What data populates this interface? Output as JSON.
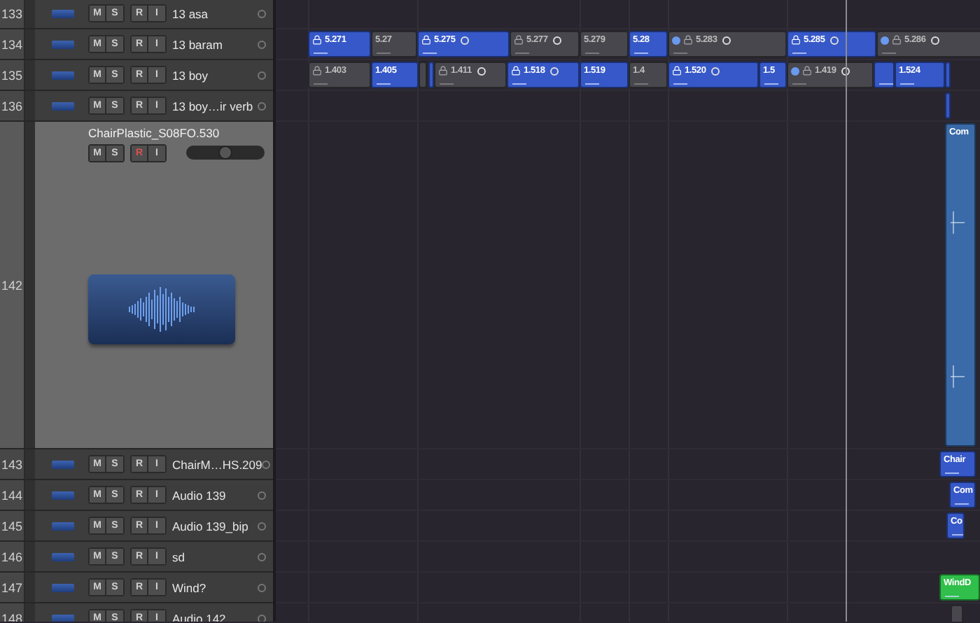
{
  "tracks": [
    {
      "number": "133",
      "name": "13 asa",
      "selected": false,
      "armed": false,
      "buttons": {
        "mute": "M",
        "solo": "S",
        "record": "R",
        "input": "I"
      }
    },
    {
      "number": "134",
      "name": "13 baram",
      "selected": false,
      "armed": false,
      "buttons": {
        "mute": "M",
        "solo": "S",
        "record": "R",
        "input": "I"
      },
      "regions": [
        {
          "label": "5.271",
          "selected": true,
          "dot": false
        },
        {
          "label": "5.27",
          "selected": false,
          "dot": false
        },
        {
          "label": "5.275",
          "selected": true,
          "dot": false
        },
        {
          "label": "5.277",
          "selected": false,
          "dot": false
        },
        {
          "label": "5.279",
          "selected": false,
          "dot": false
        },
        {
          "label": "5.28",
          "selected": true,
          "dot": false
        },
        {
          "label": "5.283",
          "selected": false,
          "dot": true
        },
        {
          "label": "5.285",
          "selected": true,
          "dot": false
        },
        {
          "label": "5.286",
          "selected": false,
          "dot": true
        }
      ]
    },
    {
      "number": "135",
      "name": "13 boy",
      "selected": false,
      "armed": false,
      "buttons": {
        "mute": "M",
        "solo": "S",
        "record": "R",
        "input": "I"
      },
      "regions": [
        {
          "label": "1.403",
          "selected": false,
          "dot": false
        },
        {
          "label": "1.405",
          "selected": true,
          "dot": false
        },
        {
          "selected": false
        },
        {
          "selected": true
        },
        {
          "label": "1.411",
          "selected": false,
          "dot": false
        },
        {
          "label": "1.518",
          "selected": true,
          "dot": false
        },
        {
          "label": "1.519",
          "selected": true,
          "dot": false
        },
        {
          "label": "1.4",
          "selected": false,
          "dot": false
        },
        {
          "label": "1.520",
          "selected": true,
          "dot": false
        },
        {
          "label": "1.5",
          "selected": true,
          "dot": false
        },
        {
          "label": "1.419",
          "selected": false,
          "dot": true
        },
        {
          "selected": true
        },
        {
          "label": "1.524",
          "selected": true,
          "dot": false
        },
        {
          "selected": true
        }
      ]
    },
    {
      "number": "136",
      "name": "13 boy…ir verb",
      "selected": false,
      "armed": false,
      "buttons": {
        "mute": "M",
        "solo": "S",
        "record": "R",
        "input": "I"
      },
      "regions": [
        {
          "selected": true
        }
      ]
    },
    {
      "number": "142",
      "name": "ChairPlastic_S08FO.530",
      "selected": true,
      "armed": true,
      "buttons": {
        "mute": "M",
        "solo": "S",
        "record": "R",
        "input": "I"
      },
      "volume": {
        "level": 0.5
      },
      "regions": [
        {
          "label": "Com",
          "selected": true,
          "dot": false
        }
      ]
    },
    {
      "number": "143",
      "name": "ChairM…HS.209",
      "selected": false,
      "armed": false,
      "buttons": {
        "mute": "M",
        "solo": "S",
        "record": "R",
        "input": "I"
      },
      "regions": [
        {
          "label": "Chair",
          "selected": true,
          "dot": false
        }
      ]
    },
    {
      "number": "144",
      "name": "Audio 139",
      "selected": false,
      "armed": false,
      "buttons": {
        "mute": "M",
        "solo": "S",
        "record": "R",
        "input": "I"
      },
      "regions": [
        {
          "label": "Com",
          "selected": true,
          "dot": false
        }
      ]
    },
    {
      "number": "145",
      "name": "Audio 139_bip",
      "selected": false,
      "armed": false,
      "buttons": {
        "mute": "M",
        "solo": "S",
        "record": "R",
        "input": "I"
      },
      "regions": [
        {
          "label": "Co",
          "selected": true,
          "dot": false
        }
      ]
    },
    {
      "number": "146",
      "name": "sd",
      "selected": false,
      "armed": false,
      "buttons": {
        "mute": "M",
        "solo": "S",
        "record": "R",
        "input": "I"
      }
    },
    {
      "number": "147",
      "name": "Wind?",
      "selected": false,
      "armed": false,
      "buttons": {
        "mute": "M",
        "solo": "S",
        "record": "R",
        "input": "I"
      },
      "regions": [
        {
          "label": "WindD",
          "selected": true,
          "dot": false,
          "kind": "midi"
        }
      ]
    },
    {
      "number": "148",
      "name": "Audio 142",
      "selected": false,
      "armed": false,
      "buttons": {
        "mute": "M",
        "solo": "S",
        "record": "R",
        "input": "I"
      },
      "regions": [
        {
          "selected": false
        }
      ]
    }
  ]
}
